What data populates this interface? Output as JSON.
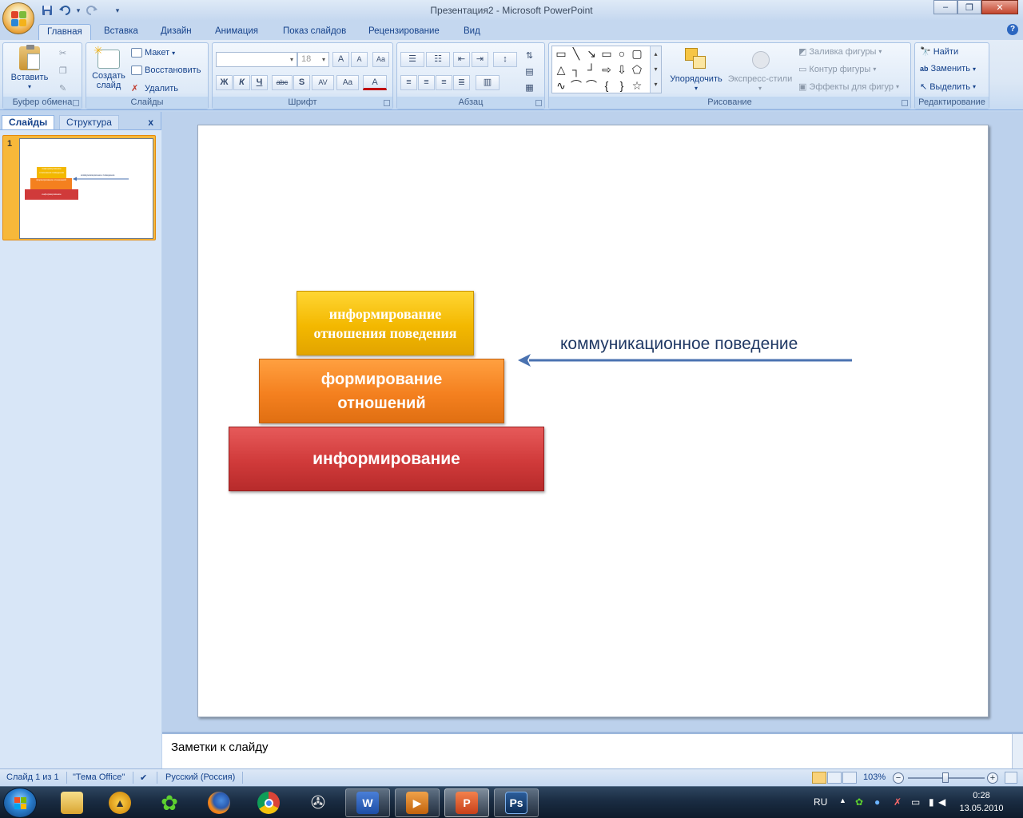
{
  "window": {
    "title": "Презентация2 - Microsoft PowerPoint",
    "minimize_glyph": "‒",
    "maximize_glyph": "❐",
    "close_glyph": "✕"
  },
  "qat": {
    "save_icon": "save-icon",
    "undo_icon": "undo-icon",
    "redo_icon": "redo-icon",
    "customize_glyph": "▾"
  },
  "tabs": [
    "Главная",
    "Вставка",
    "Дизайн",
    "Анимация",
    "Показ слайдов",
    "Рецензирование",
    "Вид"
  ],
  "ribbon": {
    "clipboard": {
      "label": "Буфер обмена",
      "paste": "Вставить",
      "paste_arrow": "▾"
    },
    "slides": {
      "label": "Слайды",
      "new_slide_1": "Создать",
      "new_slide_2": "слайд",
      "layout": "Макет",
      "reset": "Восстановить",
      "delete": "Удалить"
    },
    "font": {
      "label": "Шрифт",
      "font_name": "",
      "font_size": "18",
      "grow": "A",
      "shrink": "A",
      "clear": "Aa",
      "bold": "Ж",
      "italic": "К",
      "underline": "Ч",
      "strike": "abc",
      "shadow": "S",
      "spacing": "AV",
      "case": "Aa",
      "color": "A"
    },
    "paragraph": {
      "label": "Абзац"
    },
    "drawing": {
      "label": "Рисование",
      "arrange": "Упорядочить",
      "quick_styles": "Экспресс-стили",
      "fill": "Заливка фигуры",
      "outline": "Контур фигуры",
      "effects": "Эффекты для фигур"
    },
    "editing": {
      "label": "Редактирование",
      "find": "Найти",
      "replace": "Заменить",
      "select": "Выделить"
    }
  },
  "left_panel": {
    "tab_slides": "Слайды",
    "tab_outline": "Структура",
    "close": "x",
    "slide_number": "1",
    "thumb_top": "информирование отношения поведения",
    "thumb_mid": "формирование отношений",
    "thumb_bot": "информирование",
    "thumb_arrow_label": "коммуникационное поведение"
  },
  "slide": {
    "box_top_line1": "информирование",
    "box_top_line2": "отношения поведения",
    "box_mid_line1": "формирование",
    "box_mid_line2": "отношений",
    "box_bottom": "информирование",
    "arrow_label": "коммуникационное поведение",
    "colors": {
      "top": "#f3b800",
      "mid": "#f4801f",
      "bottom": "#d03a3a",
      "arrow": "#4a72b0",
      "label": "#1f3864"
    }
  },
  "notes": {
    "placeholder": "Заметки к слайду"
  },
  "status": {
    "slide_info": "Слайд 1 из 1",
    "theme": "\"Тема Office\"",
    "language": "Русский (Россия)",
    "zoom": "103%",
    "zoom_out": "−",
    "zoom_in": "+"
  },
  "taskbar": {
    "apps": [
      "explorer",
      "aimp",
      "icq",
      "firefox",
      "chrome",
      "media-player",
      "word",
      "video",
      "powerpoint",
      "photoshop"
    ],
    "word_label": "W",
    "ps_label": "Ps",
    "lang": "RU",
    "time": "0:28",
    "date": "13.05.2010"
  }
}
